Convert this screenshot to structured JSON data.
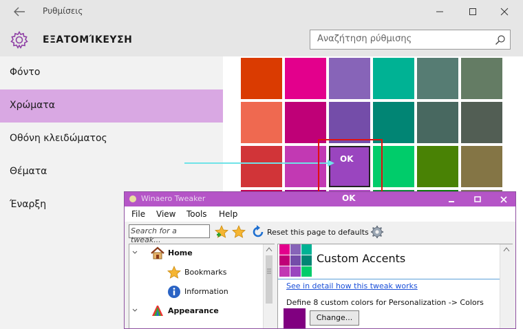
{
  "settings": {
    "window_title": "Ρυθμίσεις",
    "page_title": "ΕΞΑΤΟΜΊΚΕΥΣΗ",
    "search_placeholder": "Αναζήτηση ρύθμισης",
    "nav": [
      "Φόντο",
      "Χρώματα",
      "Οθόνη κλειδώματος",
      "Θέματα",
      "Έναρξη"
    ],
    "selected_nav": "Χρώματα",
    "swatch_colors": [
      [
        "#da3b01",
        "#e3008c",
        "#8764b8",
        "#00b294",
        "#567c73",
        "#647c64"
      ],
      [
        "#ef6950",
        "#bf0077",
        "#744da9",
        "#018574",
        "#486860",
        "#525e54"
      ],
      [
        "#d13438",
        "#c239b3",
        "#9a45bf",
        "#00cc6a",
        "#498205",
        "#847545"
      ],
      [
        "#c30052",
        "#9a0089",
        "#b146c2",
        "#10893e",
        "#107c10",
        "#7e735f"
      ]
    ],
    "ok_label": "OK",
    "accent_color": "#d9a8e3"
  },
  "tweaker": {
    "window_title": "Winaero Tweaker",
    "title_ok": "OK",
    "title_bar_color": "#b555c7",
    "menu": [
      "File",
      "View",
      "Tools",
      "Help"
    ],
    "search_placeholder": "Search for a tweak...",
    "reset_label": "Reset this page to defaults",
    "tree": [
      {
        "label": "Home",
        "bold": true,
        "icon": "house-icon"
      },
      {
        "label": "Bookmarks",
        "bold": false,
        "icon": "star-icon"
      },
      {
        "label": "Information",
        "bold": false,
        "icon": "info-icon"
      },
      {
        "label": "Appearance",
        "bold": true,
        "icon": "palette-icon"
      }
    ],
    "panel_title": "Custom Accents",
    "detail_link": "See in detail how this tweak works",
    "description": "Define 8 custom colors for Personalization -> Colors",
    "current_color": "#800080",
    "change_button": "Change..."
  }
}
